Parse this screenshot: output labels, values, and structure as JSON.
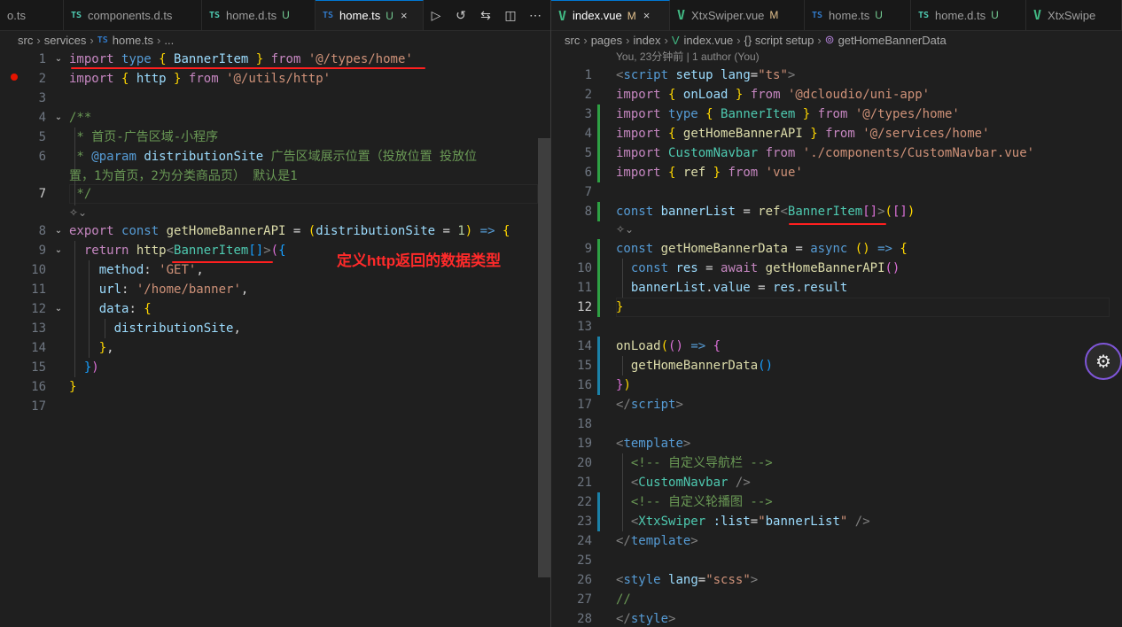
{
  "left_pane": {
    "tabs": [
      {
        "label": "o.ts",
        "icon": "",
        "status": ""
      },
      {
        "label": "components.d.ts",
        "icon": "TS",
        "status": ""
      },
      {
        "label": "home.d.ts",
        "icon": "TS",
        "status": "U"
      },
      {
        "label": "home.ts",
        "icon": "TS",
        "status": "U",
        "close": "×"
      }
    ],
    "actions": [
      "run-icon",
      "history-icon",
      "compare-icon",
      "split-editor-icon",
      "more-icon"
    ],
    "breadcrumb": {
      "parts": [
        "src",
        "services"
      ],
      "file_icon": "TS",
      "file": "home.ts",
      "tail": "..."
    },
    "line_numbers": [
      "1",
      "2",
      "3",
      "4",
      "5",
      "6",
      "",
      "7",
      "",
      "8",
      "9",
      "10",
      "11",
      "12",
      "13",
      "14",
      "15",
      "16",
      "17"
    ],
    "codelens_icon": "ai-sparkle-icon",
    "annotation": "定义http返回的数据类型"
  },
  "right_pane": {
    "tabs": [
      {
        "label": "index.vue",
        "icon": "V",
        "status": "M",
        "close": "×"
      },
      {
        "label": "XtxSwiper.vue",
        "icon": "V",
        "status": "M"
      },
      {
        "label": "home.ts",
        "icon": "TS",
        "status": "U"
      },
      {
        "label": "home.d.ts",
        "icon": "TS",
        "status": "U"
      },
      {
        "label": "XtxSwipe",
        "icon": "V",
        "status": ""
      }
    ],
    "breadcrumb": {
      "parts": [
        "src",
        "pages",
        "index"
      ],
      "file": "index.vue",
      "scope": "{} script setup",
      "symbol": "getHomeBannerData"
    },
    "blame": "You, 23分钟前 | 1 author (You)",
    "line_numbers": [
      "1",
      "2",
      "3",
      "4",
      "5",
      "6",
      "7",
      "8",
      "9",
      "10",
      "11",
      "12",
      "13",
      "14",
      "15",
      "16",
      "17",
      "18",
      "19",
      "20",
      "21",
      "22",
      "23",
      "24",
      "25",
      "26",
      "27",
      "28"
    ],
    "codelens_icon": "ai-sparkle-icon",
    "assistant_icon": "copilot-icon"
  },
  "colors": {
    "background": "#1f1f1f",
    "annotation_red": "#ff1f1f",
    "tab_active_border": "#0078d4"
  }
}
